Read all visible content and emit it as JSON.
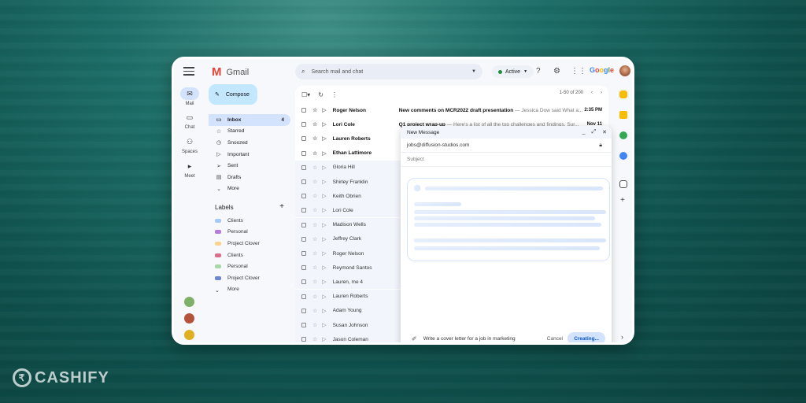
{
  "app": {
    "name": "Gmail",
    "search_placeholder": "Search mail and chat",
    "status": "Active",
    "brand": "Google"
  },
  "rail": {
    "items": [
      {
        "label": "Mail",
        "icon": "mail-icon"
      },
      {
        "label": "Chat",
        "icon": "chat-icon"
      },
      {
        "label": "Spaces",
        "icon": "spaces-icon"
      },
      {
        "label": "Meet",
        "icon": "meet-icon"
      }
    ]
  },
  "compose": {
    "label": "Compose"
  },
  "nav": {
    "items": [
      {
        "label": "Inbox",
        "count": "4",
        "icon": "inbox-icon"
      },
      {
        "label": "Starred",
        "icon": "star-icon"
      },
      {
        "label": "Snoozed",
        "icon": "clock-icon"
      },
      {
        "label": "Important",
        "icon": "important-icon"
      },
      {
        "label": "Sent",
        "icon": "send-icon"
      },
      {
        "label": "Drafts",
        "icon": "draft-icon"
      },
      {
        "label": "More",
        "icon": "chevron-down-icon"
      }
    ]
  },
  "labels": {
    "title": "Labels",
    "items": [
      {
        "label": "Clients",
        "color": "#a8c7fa"
      },
      {
        "label": "Personal",
        "color": "#b57bde"
      },
      {
        "label": "Project Clover",
        "color": "#fbd38d"
      },
      {
        "label": "Clients",
        "color": "#e06c8c"
      },
      {
        "label": "Personal",
        "color": "#a8d8a8"
      },
      {
        "label": "Project Clover",
        "color": "#6f86d6"
      }
    ],
    "more": "More"
  },
  "mail": {
    "pager": "1-50 of 200",
    "rows": [
      {
        "sender": "Roger Nelson",
        "subject": "New comments on MCR2022 draft presentation",
        "snippet": " — Jessica Dow said What a...",
        "time": "2:35 PM",
        "unread": true
      },
      {
        "sender": "Lori Cole",
        "subject": "Q1 project wrap-up",
        "snippet": " — Here's a list of all the top challenges and findings. Sur...",
        "time": "Nov 11",
        "unread": true
      },
      {
        "sender": "Lauren Roberts",
        "subject": "",
        "snippet": "",
        "time": "",
        "unread": true
      },
      {
        "sender": "Ethan Lattimore",
        "subject": "",
        "snippet": "",
        "time": "",
        "unread": true
      },
      {
        "sender": "Gloria Hill",
        "subject": "",
        "snippet": "",
        "time": "",
        "unread": false
      },
      {
        "sender": "Shirley Franklin",
        "subject": "",
        "snippet": "",
        "time": "",
        "unread": false
      },
      {
        "sender": "Keith Obrien",
        "subject": "",
        "snippet": "",
        "time": "",
        "unread": false
      },
      {
        "sender": "Lori Cole",
        "subject": "",
        "snippet": "",
        "time": "",
        "unread": false
      },
      {
        "sender": "Madison Wells",
        "subject": "",
        "snippet": "",
        "time": "",
        "unread": false
      },
      {
        "sender": "Jeffrey Clark",
        "subject": "",
        "snippet": "",
        "time": "",
        "unread": false
      },
      {
        "sender": "Roger Nelson",
        "subject": "",
        "snippet": "",
        "time": "",
        "unread": false
      },
      {
        "sender": "Reymond Santos",
        "subject": "",
        "snippet": "",
        "time": "",
        "unread": false
      },
      {
        "sender": "Lauren, me  4",
        "subject": "",
        "snippet": "",
        "time": "",
        "unread": false
      },
      {
        "sender": "Lauren Roberts",
        "subject": "",
        "snippet": "",
        "time": "",
        "unread": false
      },
      {
        "sender": "Adam Young",
        "subject": "",
        "snippet": "",
        "time": "",
        "unread": false
      },
      {
        "sender": "Susan Johnson",
        "subject": "",
        "snippet": "",
        "time": "",
        "unread": false
      },
      {
        "sender": "Jason Coleman",
        "subject": "",
        "snippet": "",
        "time": "",
        "unread": false
      }
    ]
  },
  "dialog": {
    "title": "New Message",
    "to": "jobs@diffusion-studios.com",
    "subject_placeholder": "Subject",
    "prompt": "Write a cover letter for a job in marketing",
    "cancel": "Cancel",
    "creating": "Creating..."
  },
  "watermark": {
    "text": "CASHIFY"
  }
}
